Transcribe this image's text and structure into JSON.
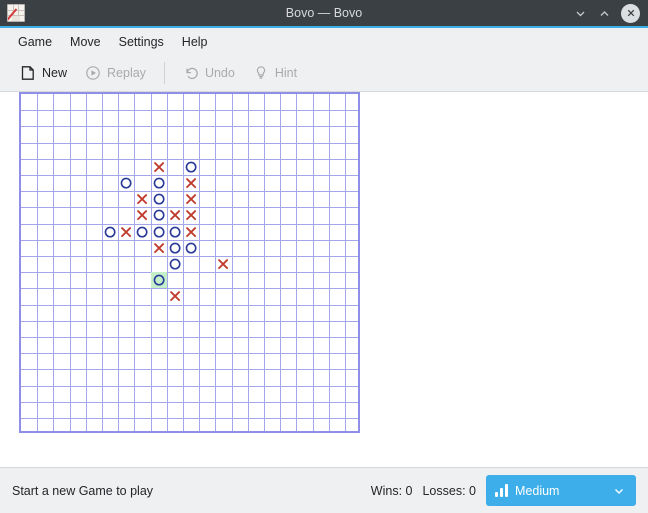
{
  "window": {
    "title": "Bovo — Bovo",
    "app_icon": "bovo-grid-pen-icon",
    "controls": [
      {
        "name": "minimize",
        "icon": "chevron-down-icon"
      },
      {
        "name": "maximize",
        "icon": "chevron-up-icon"
      },
      {
        "name": "close",
        "icon": "close-x-icon"
      }
    ],
    "accent_color": "#3daee9",
    "titlebar_color": "#3b4045"
  },
  "menubar": {
    "items": [
      {
        "label": "Game"
      },
      {
        "label": "Move"
      },
      {
        "label": "Settings"
      },
      {
        "label": "Help"
      }
    ]
  },
  "toolbar": {
    "items": [
      {
        "label": "New",
        "icon": "new-document-icon",
        "enabled": true
      },
      {
        "label": "Replay",
        "icon": "play-circle-icon",
        "enabled": false
      },
      {
        "label": "Undo",
        "icon": "undo-arrow-icon",
        "enabled": false
      },
      {
        "label": "Hint",
        "icon": "lightbulb-icon",
        "enabled": false
      }
    ]
  },
  "board": {
    "columns": 21,
    "rows": 21,
    "cell_size": 16.2,
    "grid_color": "#a5a5ec",
    "border_color": "#8f8fe8",
    "background": "#ffffff",
    "x_color": "#c0392b",
    "o_color": "#2a3a99",
    "highlight_color": "#c3f0c8",
    "highlight_cell": {
      "col": 8,
      "row": 11
    },
    "moves": [
      {
        "col": 8,
        "row": 4,
        "player": "X"
      },
      {
        "col": 10,
        "row": 4,
        "player": "O"
      },
      {
        "col": 6,
        "row": 5,
        "player": "O"
      },
      {
        "col": 8,
        "row": 5,
        "player": "O"
      },
      {
        "col": 10,
        "row": 5,
        "player": "X"
      },
      {
        "col": 7,
        "row": 6,
        "player": "X"
      },
      {
        "col": 8,
        "row": 6,
        "player": "O"
      },
      {
        "col": 10,
        "row": 6,
        "player": "X"
      },
      {
        "col": 7,
        "row": 7,
        "player": "X"
      },
      {
        "col": 8,
        "row": 7,
        "player": "O"
      },
      {
        "col": 9,
        "row": 7,
        "player": "X"
      },
      {
        "col": 10,
        "row": 7,
        "player": "X"
      },
      {
        "col": 5,
        "row": 8,
        "player": "O"
      },
      {
        "col": 6,
        "row": 8,
        "player": "X"
      },
      {
        "col": 7,
        "row": 8,
        "player": "O"
      },
      {
        "col": 8,
        "row": 8,
        "player": "O"
      },
      {
        "col": 9,
        "row": 8,
        "player": "O"
      },
      {
        "col": 10,
        "row": 8,
        "player": "X"
      },
      {
        "col": 8,
        "row": 9,
        "player": "X"
      },
      {
        "col": 9,
        "row": 9,
        "player": "O"
      },
      {
        "col": 10,
        "row": 9,
        "player": "O"
      },
      {
        "col": 9,
        "row": 10,
        "player": "O"
      },
      {
        "col": 12,
        "row": 10,
        "player": "X"
      },
      {
        "col": 8,
        "row": 11,
        "player": "O"
      },
      {
        "col": 9,
        "row": 12,
        "player": "X"
      }
    ]
  },
  "statusbar": {
    "message": "Start a new Game to play",
    "wins_label": "Wins: 0",
    "losses_label": "Losses: 0",
    "difficulty": {
      "value": "Medium",
      "icon": "bar-chart-icon",
      "chevron": "chevron-down-icon",
      "color": "#3daee9"
    }
  }
}
